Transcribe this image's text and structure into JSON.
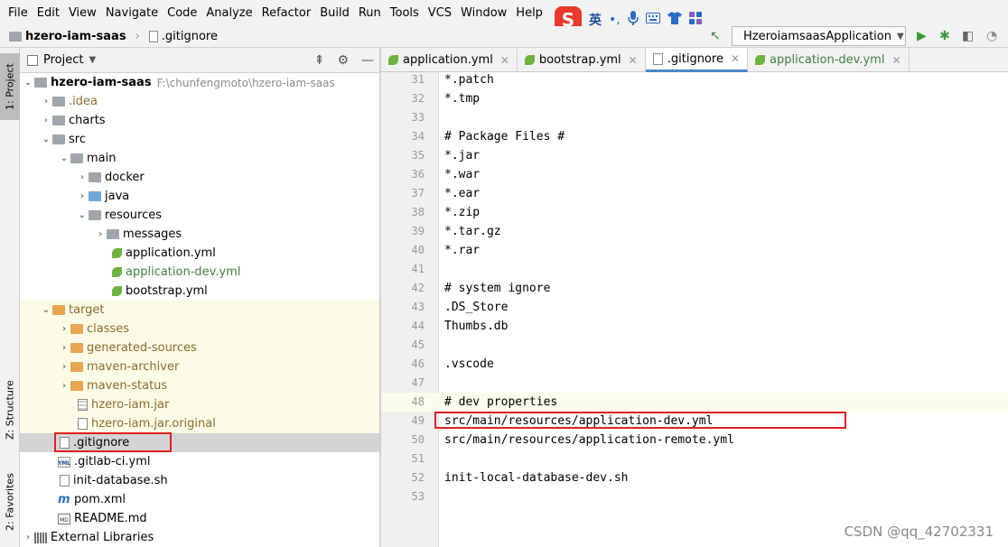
{
  "menu": [
    "File",
    "Edit",
    "View",
    "Navigate",
    "Code",
    "Analyze",
    "Refactor",
    "Build",
    "Run",
    "Tools",
    "VCS",
    "Window",
    "Help"
  ],
  "ime": {
    "logo": "S",
    "lang": "英",
    "punct": "•,",
    "mic_icon": "microphone-icon",
    "keyboard_icon": "keyboard-icon",
    "skin_icon": "shirt-icon",
    "apps_icon": "apps-grid-icon"
  },
  "breadcrumb": {
    "project": "hzero-iam-saas",
    "file": ".gitignore"
  },
  "run_config": {
    "name": "HzeroiamsaasApplication"
  },
  "panel": {
    "title": "Project"
  },
  "strip": {
    "project": "1: Project",
    "structure": "Z: Structure",
    "favorites": "2: Favorites"
  },
  "tree": [
    {
      "name": "hzero-iam-saas",
      "path": "F:\\chunfengmoto\\hzero-iam-saas"
    },
    {
      "name": ".idea"
    },
    {
      "name": "charts"
    },
    {
      "name": "src"
    },
    {
      "name": "main"
    },
    {
      "name": "docker"
    },
    {
      "name": "java"
    },
    {
      "name": "resources"
    },
    {
      "name": "messages"
    },
    {
      "name": "application.yml"
    },
    {
      "name": "application-dev.yml"
    },
    {
      "name": "bootstrap.yml"
    },
    {
      "name": "target"
    },
    {
      "name": "classes"
    },
    {
      "name": "generated-sources"
    },
    {
      "name": "maven-archiver"
    },
    {
      "name": "maven-status"
    },
    {
      "name": "hzero-iam.jar"
    },
    {
      "name": "hzero-iam.jar.original"
    },
    {
      "name": ".gitignore"
    },
    {
      "name": ".gitlab-ci.yml"
    },
    {
      "name": "init-database.sh"
    },
    {
      "name": "pom.xml"
    },
    {
      "name": "README.md"
    },
    {
      "name": "External Libraries"
    }
  ],
  "tabs": [
    "application.yml",
    "bootstrap.yml",
    ".gitignore",
    "application-dev.yml"
  ],
  "editor": {
    "lines": [
      {
        "no": "31",
        "text": "*.patch"
      },
      {
        "no": "32",
        "text": "*.tmp"
      },
      {
        "no": "33",
        "text": ""
      },
      {
        "no": "34",
        "text": "# Package Files #"
      },
      {
        "no": "35",
        "text": "*.jar"
      },
      {
        "no": "36",
        "text": "*.war"
      },
      {
        "no": "37",
        "text": "*.ear"
      },
      {
        "no": "38",
        "text": "*.zip"
      },
      {
        "no": "39",
        "text": "*.tar.gz"
      },
      {
        "no": "40",
        "text": "*.rar"
      },
      {
        "no": "41",
        "text": ""
      },
      {
        "no": "42",
        "text": "# system ignore"
      },
      {
        "no": "43",
        "text": ".DS_Store"
      },
      {
        "no": "44",
        "text": "Thumbs.db"
      },
      {
        "no": "45",
        "text": ""
      },
      {
        "no": "46",
        "text": ".vscode"
      },
      {
        "no": "47",
        "text": ""
      },
      {
        "no": "48",
        "text": "# dev properties"
      },
      {
        "no": "49",
        "text": "src/main/resources/application-dev.yml"
      },
      {
        "no": "50",
        "text": "src/main/resources/application-remote.yml"
      },
      {
        "no": "51",
        "text": ""
      },
      {
        "no": "52",
        "text": "init-local-database-dev.sh"
      },
      {
        "no": "53",
        "text": ""
      }
    ]
  },
  "watermark": "CSDN @qq_42702331"
}
